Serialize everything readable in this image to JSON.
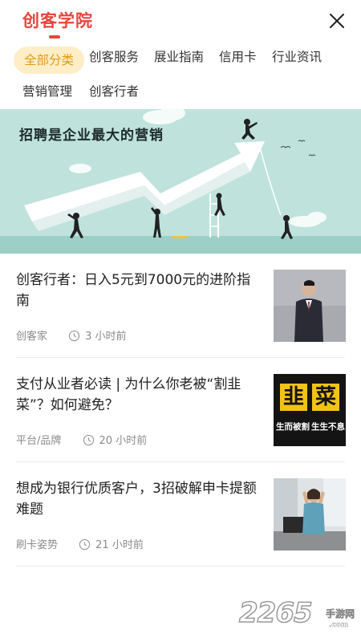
{
  "header": {
    "title": "创客学院",
    "close_icon": "close-icon"
  },
  "tabs": [
    {
      "label": "全部分类",
      "active": true
    },
    {
      "label": "创客服务",
      "active": false
    },
    {
      "label": "展业指南",
      "active": false
    },
    {
      "label": "信用卡",
      "active": false
    },
    {
      "label": "行业资讯",
      "active": false
    },
    {
      "label": "营销管理",
      "active": false
    },
    {
      "label": "创客行者",
      "active": false
    }
  ],
  "banner": {
    "text": "招聘是企业最大的营销"
  },
  "news": [
    {
      "title": "创客行者：日入5元到7000元的进阶指南",
      "source": "创客家",
      "time": "3 小时前",
      "thumb": "man-in-suit-photo"
    },
    {
      "title": "支付从业者必读 | 为什么你老被“割韭菜”？如何避免？",
      "source": "平台/品牌",
      "time": "20 小时前",
      "thumb": "jiucai-poster",
      "thumb_chars": [
        "韭",
        "菜"
      ],
      "thumb_captions": [
        "生而被割",
        "生生不息"
      ]
    },
    {
      "title": "想成为银行优质客户，3招破解申卡提额难题",
      "source": "刷卡姿势",
      "time": "21 小时前",
      "thumb": "stressed-woman-photo"
    }
  ],
  "watermark": {
    "number": "2265",
    "suffix": "手游网",
    "domain": ".com"
  },
  "colors": {
    "accent": "#e8443b",
    "active_tab_bg": "#fdeec8",
    "active_tab_text": "#e39a16",
    "banner_bg": "#bfe3dc"
  }
}
